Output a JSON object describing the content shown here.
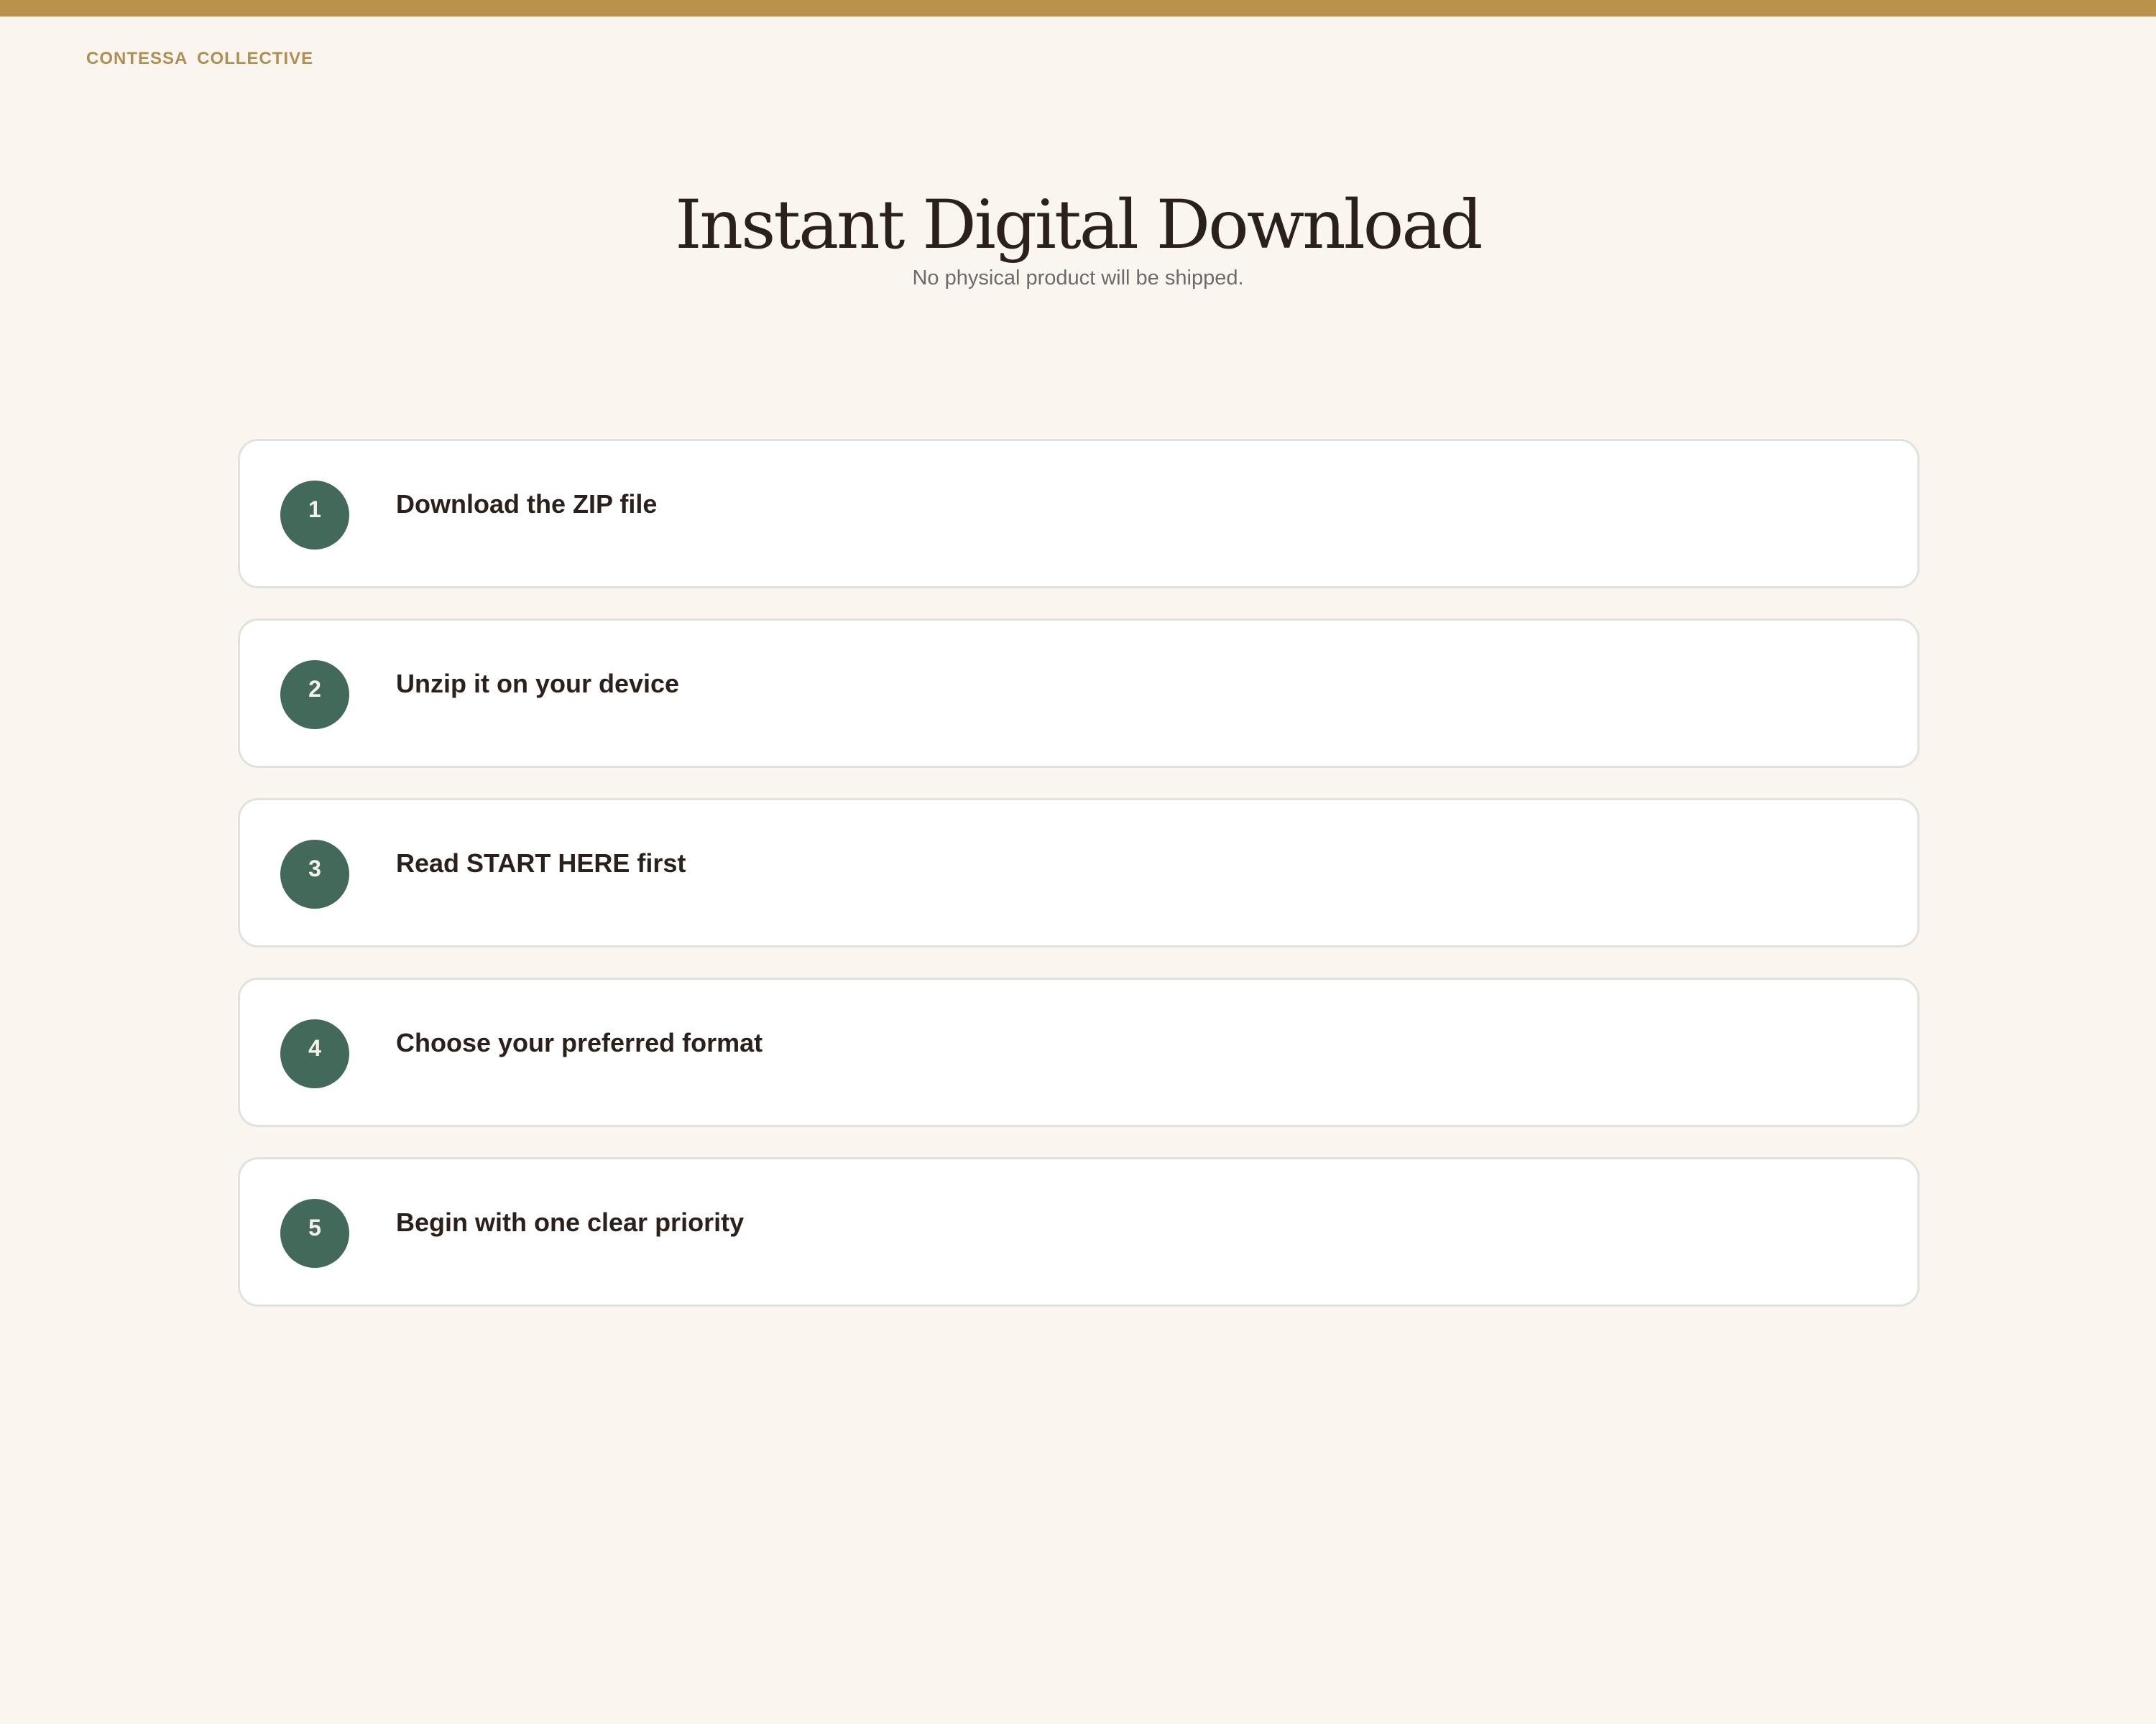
{
  "brand": {
    "name": "CONTESSA  COLLECTIVE"
  },
  "header": {
    "title": "Instant Digital Download",
    "subtitle": "No physical product will be shipped."
  },
  "steps": [
    {
      "number": "1",
      "label": "Download the ZIP file"
    },
    {
      "number": "2",
      "label": "Unzip it on your device"
    },
    {
      "number": "3",
      "label": "Read START HERE first"
    },
    {
      "number": "4",
      "label": "Choose your preferred format"
    },
    {
      "number": "5",
      "label": "Begin with one clear priority"
    }
  ],
  "colors": {
    "background": "#faf5ef",
    "accent_bar": "#bb924c",
    "brand_text": "#b08f52",
    "badge": "#43695a",
    "heading_text": "#2b201b",
    "subtitle_text": "#6b6b6b",
    "card_border": "#dfe3df"
  }
}
